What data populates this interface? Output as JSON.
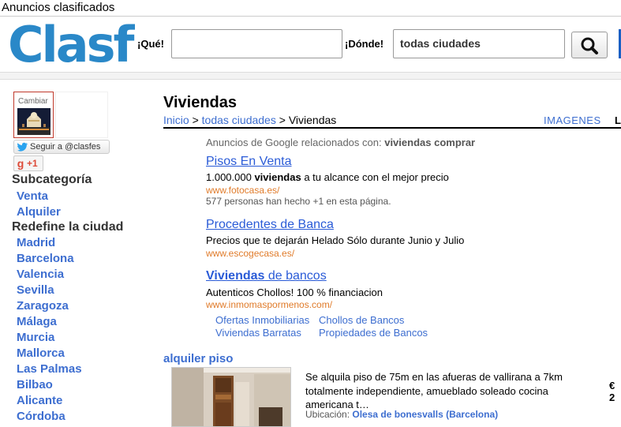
{
  "window_title": "Anuncios clasificados",
  "header": {
    "logo_text": "Clasf",
    "what_label": "¡Qué!",
    "what_value": "",
    "where_label": "¡Dónde!",
    "where_value": "todas ciudades"
  },
  "sidebar": {
    "change_label": "Cambiar",
    "follow_label": "Seguir a @clasfes",
    "gplus_label": "+1",
    "subcategory_heading": "Subcategoría",
    "subcategories": [
      "Venta",
      "Alquiler"
    ],
    "city_heading": "Redefine la ciudad",
    "cities": [
      "Madrid",
      "Barcelona",
      "Valencia",
      "Sevilla",
      "Zaragoza",
      "Málaga",
      "Murcia",
      "Mallorca",
      "Las Palmas",
      "Bilbao",
      "Alicante",
      "Córdoba"
    ]
  },
  "main": {
    "title": "Viviendas",
    "breadcrumb": {
      "home": "Inicio",
      "sep1": " > ",
      "all_cities": "todas ciudades",
      "sep2": " > ",
      "current": "Viviendas"
    },
    "tabs": {
      "images": "IMAGENES",
      "list": "L"
    }
  },
  "ads": {
    "header_prefix": "Anuncios de Google relacionados con: ",
    "header_query": "viviendas comprar",
    "items": [
      {
        "title": "Pisos En Venta",
        "desc_prefix": "1.000.000 ",
        "desc_bold": "viviendas",
        "desc_suffix": " a tu alcance con el mejor precio",
        "url": "www.fotocasa.es/",
        "note": "577 personas han hecho +1 en esta página."
      },
      {
        "title": "Procedentes de Banca",
        "desc": "Precios que te dejarán Helado Sólo durante Junio y Julio",
        "url": "www.escogecasa.es/"
      },
      {
        "title_bold": "Viviendas",
        "title_rest": " de bancos",
        "desc": "Autenticos Chollos! 100 % financiacion",
        "url": "www.inmomaspormenos.com/",
        "sublinks": [
          "Ofertas Inmobiliarias",
          "Chollos de Bancos",
          "Viviendas Barratas",
          "Propiedades de Bancos"
        ]
      }
    ]
  },
  "listing": {
    "title": "alquiler piso",
    "description": "Se alquila piso de 75m en las afueras de vallirana a 7km totalmente independiente, amueblado soleado cocina americana t…",
    "location_label": "Ubicación: ",
    "location_value": "Olesa de bonesvalls (Barcelona)",
    "price": "€ 2"
  },
  "colors": {
    "link_blue": "#3d6ed0",
    "ad_title_blue": "#2a5bd7",
    "ad_url_orange": "#e07b2a",
    "logo_blue": "#2a88c8",
    "accent_blue": "#1a5fc4"
  }
}
